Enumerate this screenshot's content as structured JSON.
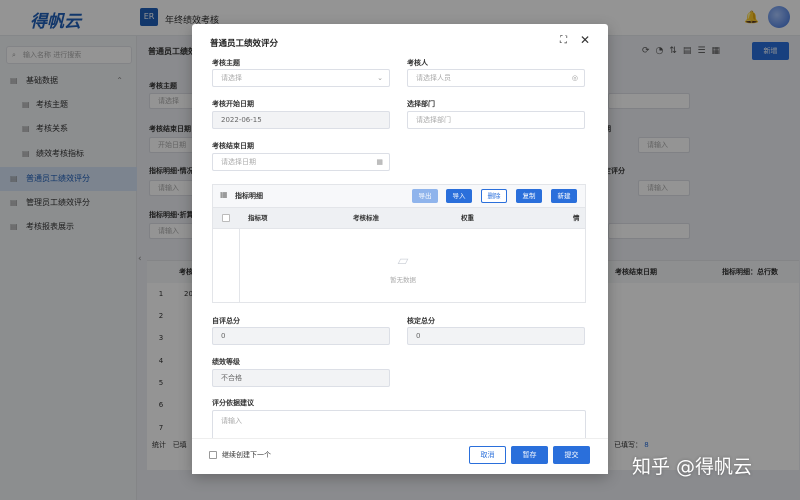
{
  "app": {
    "logo": "得帆云",
    "title": "年终绩效考核",
    "icon_text": "ER"
  },
  "sidebar": {
    "search_placeholder": "输入名称 进行搜索",
    "items": [
      {
        "label": "基础数据"
      },
      {
        "label": "考核主题"
      },
      {
        "label": "考核关系"
      },
      {
        "label": "绩效考核指标"
      },
      {
        "label": "普通员工绩效评分"
      },
      {
        "label": "管理员工绩效评分"
      },
      {
        "label": "考核报表展示"
      }
    ]
  },
  "background": {
    "title": "普通员工绩效",
    "new_button": "新增",
    "labels": {
      "theme": "考核主题",
      "end": "考核结束日期",
      "detail1": "指标明细·情况",
      "detail2": "指标明细·折算",
      "right1": "期",
      "right2": "定评分"
    },
    "inputs": {
      "select": "请选择",
      "start": "开始日期",
      "input": "请输入",
      "input2": "请输入",
      "input3": "请输入",
      "input4": "请输入"
    },
    "table": {
      "headers": [
        "考核",
        "考核结束日期",
        "指标明细：总行数"
      ],
      "first_cell": "20",
      "rows": [
        "1",
        "2",
        "3",
        "4",
        "5",
        "6",
        "7"
      ],
      "stat": "统计",
      "stat2": "已填",
      "filled": "已填写：",
      "filled_count": "8"
    }
  },
  "modal": {
    "title": "普通员工绩效评分",
    "fields": {
      "theme_label": "考核主题",
      "theme_placeholder": "请选择",
      "person_label": "考核人",
      "person_placeholder": "请选择人员",
      "start_label": "考核开始日期",
      "start_value": "2022-06-15",
      "dept_label": "选择部门",
      "dept_placeholder": "请选择部门",
      "end_label": "考核结束日期",
      "end_placeholder": "请选择日期",
      "self_label": "自评总分",
      "self_value": "0",
      "check_label": "核定总分",
      "check_value": "0",
      "grade_label": "绩效等级",
      "grade_value": "不合格",
      "advice_label": "评分依据建议",
      "advice_placeholder": "请输入"
    },
    "subtable": {
      "title": "指标明细",
      "buttons": {
        "export": "导出",
        "import": "导入",
        "delete": "删除",
        "copy": "复制",
        "new": "新建"
      },
      "columns": [
        "指标项",
        "考核标准",
        "权重",
        "情"
      ],
      "empty": "暂无数据"
    },
    "footer": {
      "continue": "继续创建下一个",
      "cancel": "取消",
      "save": "暂存",
      "submit": "提交"
    }
  },
  "watermark": "知乎 @得帆云"
}
